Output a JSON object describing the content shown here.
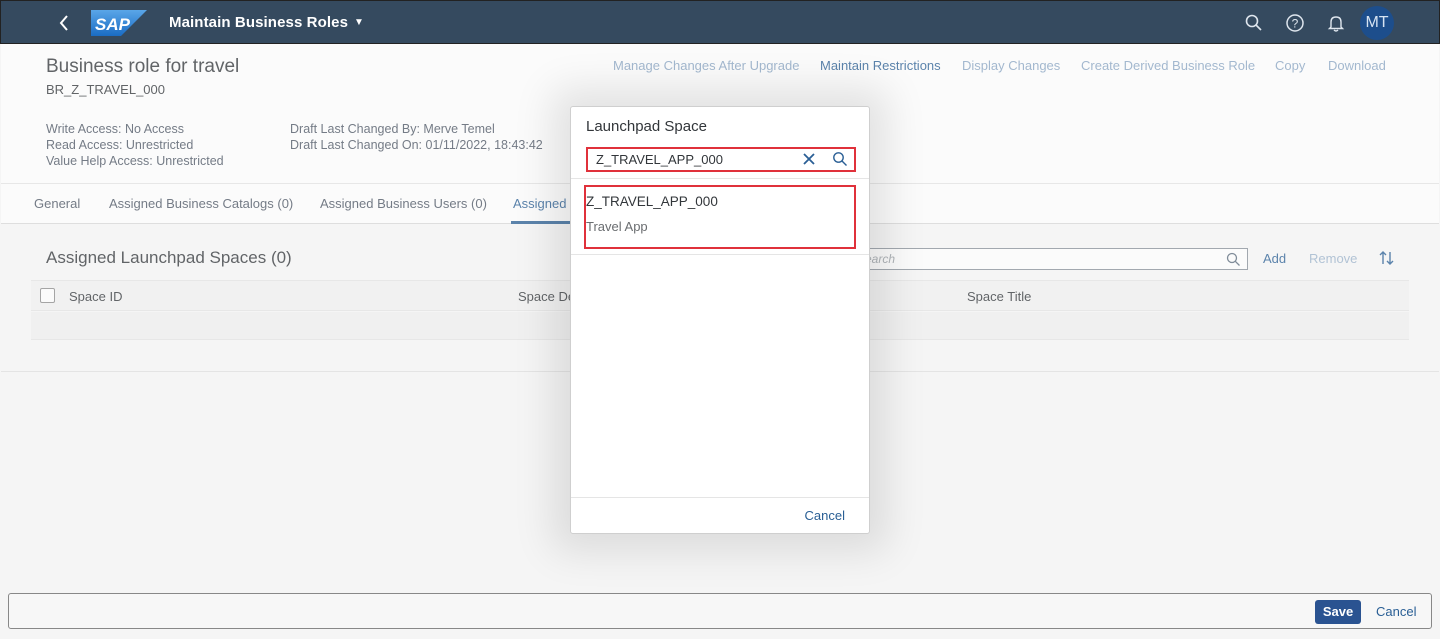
{
  "shell": {
    "app_title": "Maintain Business Roles",
    "logo_text": "SAP",
    "avatar_initials": "MT",
    "icons": [
      "back-icon",
      "search-icon",
      "help-icon",
      "bell-icon"
    ]
  },
  "header": {
    "title": "Business role for travel",
    "id": "BR_Z_TRAVEL_000",
    "write_access": "Write Access: No Access",
    "read_access": "Read Access: Unrestricted",
    "value_help_access": "Value Help Access: Unrestricted",
    "draft_changed_by": "Draft Last Changed By: Merve Temel",
    "draft_changed_on": "Draft Last Changed On: 01/11/2022, 18:43:42",
    "actions": {
      "manage_changes": "Manage Changes After Upgrade",
      "maintain_restrictions": "Maintain Restrictions",
      "display_changes": "Display Changes",
      "create_derived": "Create Derived Business Role",
      "copy": "Copy",
      "download": "Download"
    }
  },
  "tabs": {
    "general": "General",
    "catalogs": "Assigned Business Catalogs (0)",
    "users": "Assigned Business Users (0)",
    "spaces": "Assigned"
  },
  "section": {
    "title": "Assigned Launchpad Spaces (0)",
    "search_placeholder": "Search",
    "add": "Add",
    "remove": "Remove",
    "columns": {
      "space_id": "Space ID",
      "space_description": "Space De",
      "space_title": "Space Title"
    }
  },
  "dialog": {
    "title": "Launchpad Space",
    "search_value": "Z_TRAVEL_APP_000",
    "result": {
      "title": "Z_TRAVEL_APP_000",
      "description": "Travel App"
    },
    "cancel": "Cancel"
  },
  "footer": {
    "save": "Save",
    "cancel": "Cancel"
  },
  "colors": {
    "shell": "#354a5f",
    "link": "#2a5f95",
    "highlight": "#e0313b",
    "primary_button": "#2a5391"
  }
}
